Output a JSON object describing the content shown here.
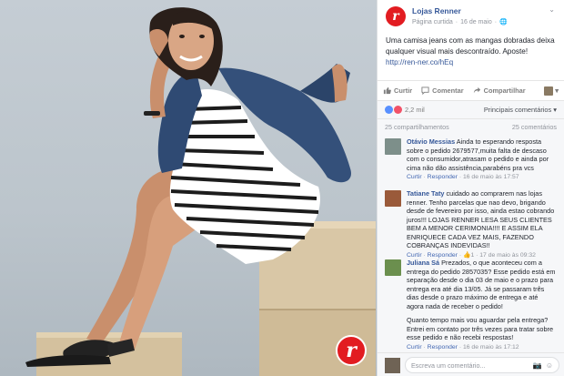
{
  "post": {
    "page_name": "Lojas Renner",
    "logo_letter": "r",
    "liked_label": "Página curtida",
    "date": "16 de maio",
    "message": "Uma camisa jeans com as mangas dobradas deixa qualquer visual mais descontraído. Aposte!",
    "link": "http://ren-ner.co/hEq"
  },
  "actions": {
    "like": "Curtir",
    "comment": "Comentar",
    "share": "Compartilhar"
  },
  "reactions": {
    "count": "2,2 mil",
    "sort_label": "Principais comentários"
  },
  "counts": {
    "shares": "25 compartilhamentos",
    "comments": "25 comentários"
  },
  "comments": [
    {
      "author": "Otávio Messias",
      "text": "Ainda to esperando resposta sobre o pedido 2679577,muita falta de descaso com o consumidor,atrasam o pedido e ainda por cima não dão assistência,parabéns pra vcs",
      "like": "Curtir",
      "reply": "Responder",
      "time": "16 de maio às 17:57",
      "avatar_color": "#7d8f8a"
    },
    {
      "author": "Tatiane Taty",
      "text": "cuidado ao comprarem nas lojas renner. Tenho parcelas que nao devo, brigando desde de fevereiro por isso, ainda estao cobrando juros!!! LOJAS RENNER LESA SEUS CLIENTES BEM A MENOR CERIMONIA!!!! E ASSIM ELA ENRIQUECE CADA VEZ MAIS, FAZENDO COBRANÇAS INDEVIDAS!!",
      "like": "Curtir",
      "reply": "Responder",
      "likes_count": "1",
      "time": "17 de maio às 09:32",
      "avatar_color": "#9a5a3a"
    },
    {
      "author": "Juliana Sá",
      "text": "Prezados, o que aconteceu com a entrega do pedido 2857035? Esse pedido está em separação desde o dia 03 de maio e o prazo para entrega era até dia 13/05. Já se passaram três dias desde o prazo máximo de entrega e até agora nada de receber o pedido!",
      "text2": "Quanto tempo mais vou aguardar pela entrega? Entrei em contato por três vezes para tratar sobre esse pedido e não recebi respostas!",
      "like": "Curtir",
      "reply": "Responder",
      "time": "16 de maio às 17:12",
      "avatar_color": "#6b8f4e"
    }
  ],
  "reply_box": {
    "placeholder": "Escreva um comentário..."
  },
  "photo": {
    "badge_letter": "r"
  },
  "colors": {
    "brand": "#e21c21",
    "link": "#365899",
    "muted": "#90949c"
  }
}
